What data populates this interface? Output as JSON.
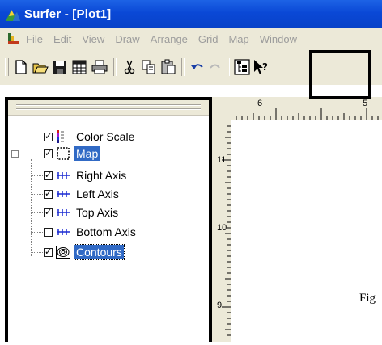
{
  "window": {
    "title": "Surfer - [Plot1]"
  },
  "menu": {
    "items": [
      "File",
      "Edit",
      "View",
      "Draw",
      "Arrange",
      "Grid",
      "Map",
      "Window"
    ]
  },
  "toolbar": {
    "buttons": [
      {
        "icon": "new-document-icon"
      },
      {
        "icon": "open-folder-icon"
      },
      {
        "icon": "save-disk-icon"
      },
      {
        "icon": "worksheet-icon"
      },
      {
        "icon": "print-icon"
      },
      {
        "icon": "cut-scissors-icon"
      },
      {
        "icon": "copy-icon"
      },
      {
        "icon": "paste-icon"
      },
      {
        "icon": "undo-icon"
      },
      {
        "icon": "redo-icon"
      },
      {
        "icon": "object-manager-icon"
      },
      {
        "icon": "help-pointer-icon"
      }
    ]
  },
  "object_manager": {
    "items": [
      {
        "label": "Color Scale",
        "checked": true,
        "icon": "color-scale-icon"
      },
      {
        "label": "Map",
        "checked": true,
        "icon": "map-frame-icon",
        "selected": true
      },
      {
        "label": "Right Axis",
        "checked": true,
        "icon": "axis-icon"
      },
      {
        "label": "Left Axis",
        "checked": true,
        "icon": "axis-icon"
      },
      {
        "label": "Top Axis",
        "checked": true,
        "icon": "axis-icon"
      },
      {
        "label": "Bottom Axis",
        "checked": false,
        "icon": "axis-icon"
      },
      {
        "label": "Contours",
        "checked": true,
        "icon": "contours-icon",
        "selected": true
      }
    ]
  },
  "rulers": {
    "horizontal_labels": [
      "6",
      "5"
    ],
    "vertical_labels": [
      "11",
      "10",
      "9"
    ]
  },
  "canvas": {
    "partial_text": "Fig"
  },
  "colors": {
    "titlebar": "#0a48d6",
    "selection": "#316ac5",
    "chrome": "#ece9d8"
  }
}
